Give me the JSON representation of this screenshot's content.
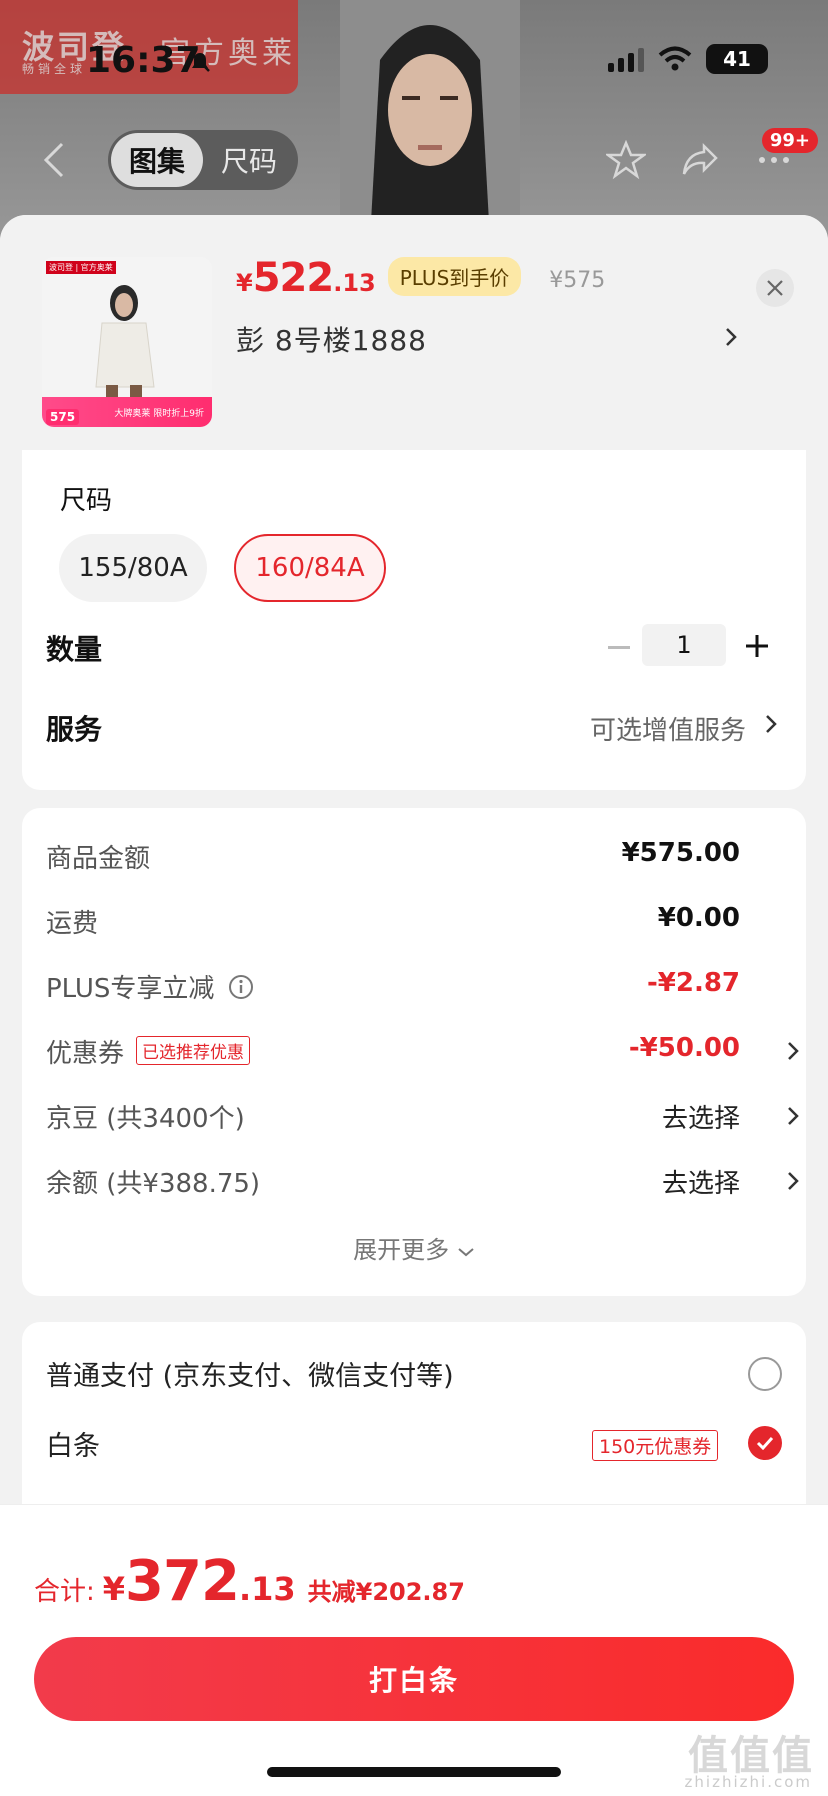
{
  "status_bar": {
    "time": "16:37",
    "battery": "41"
  },
  "background": {
    "brand_logo": "波司登",
    "brand_sub": "畅销全球",
    "store_tag": "官方奥莱",
    "segments": [
      "图集",
      "尺码"
    ],
    "cart_badge": "99+"
  },
  "product": {
    "currency": "¥",
    "price_int": "522",
    "price_dec": ".13",
    "plus_tag": "PLUS到手价",
    "original_price": "¥575",
    "address": "彭 8号楼1888",
    "thumb": {
      "brand": "波司登",
      "store": "官方奥莱",
      "price": "575",
      "promo": "大牌奥莱 限时折上9折"
    }
  },
  "size": {
    "title": "尺码",
    "options": [
      {
        "label": "155/80A",
        "selected": false
      },
      {
        "label": "160/84A",
        "selected": true
      }
    ]
  },
  "quantity": {
    "label": "数量",
    "value": "1",
    "minus": "−",
    "plus": "+"
  },
  "service": {
    "label": "服务",
    "value": "可选增值服务"
  },
  "summary": {
    "rows": [
      {
        "label": "商品金额",
        "value": "¥575.00"
      },
      {
        "label": "运费",
        "value": "¥0.00"
      },
      {
        "label": "PLUS专享立减",
        "value": "-¥2.87"
      },
      {
        "label": "优惠券",
        "tag": "已选推荐优惠",
        "value": "-¥50.00"
      },
      {
        "label": "京豆 (共3400个)",
        "value": "去选择"
      },
      {
        "label": "余额 (共¥388.75)",
        "value": "去选择"
      }
    ],
    "expand": "展开更多"
  },
  "payment": {
    "options": [
      {
        "label": "普通支付 (京东支付、微信支付等)",
        "selected": false
      },
      {
        "label": "白条",
        "selected": true,
        "tag": "150元优惠券"
      }
    ]
  },
  "footer": {
    "total_label": "合计:",
    "currency": "¥",
    "total_int": "372",
    "total_dec": ".13",
    "total_reduction": "共减¥202.87",
    "pay_button": "打白条"
  },
  "watermark": {
    "main": "值值值",
    "site": "zhizhizhi.com"
  },
  "colors": {
    "accent": "#e4262c",
    "plus_tag_bg": "#fce8a6"
  }
}
